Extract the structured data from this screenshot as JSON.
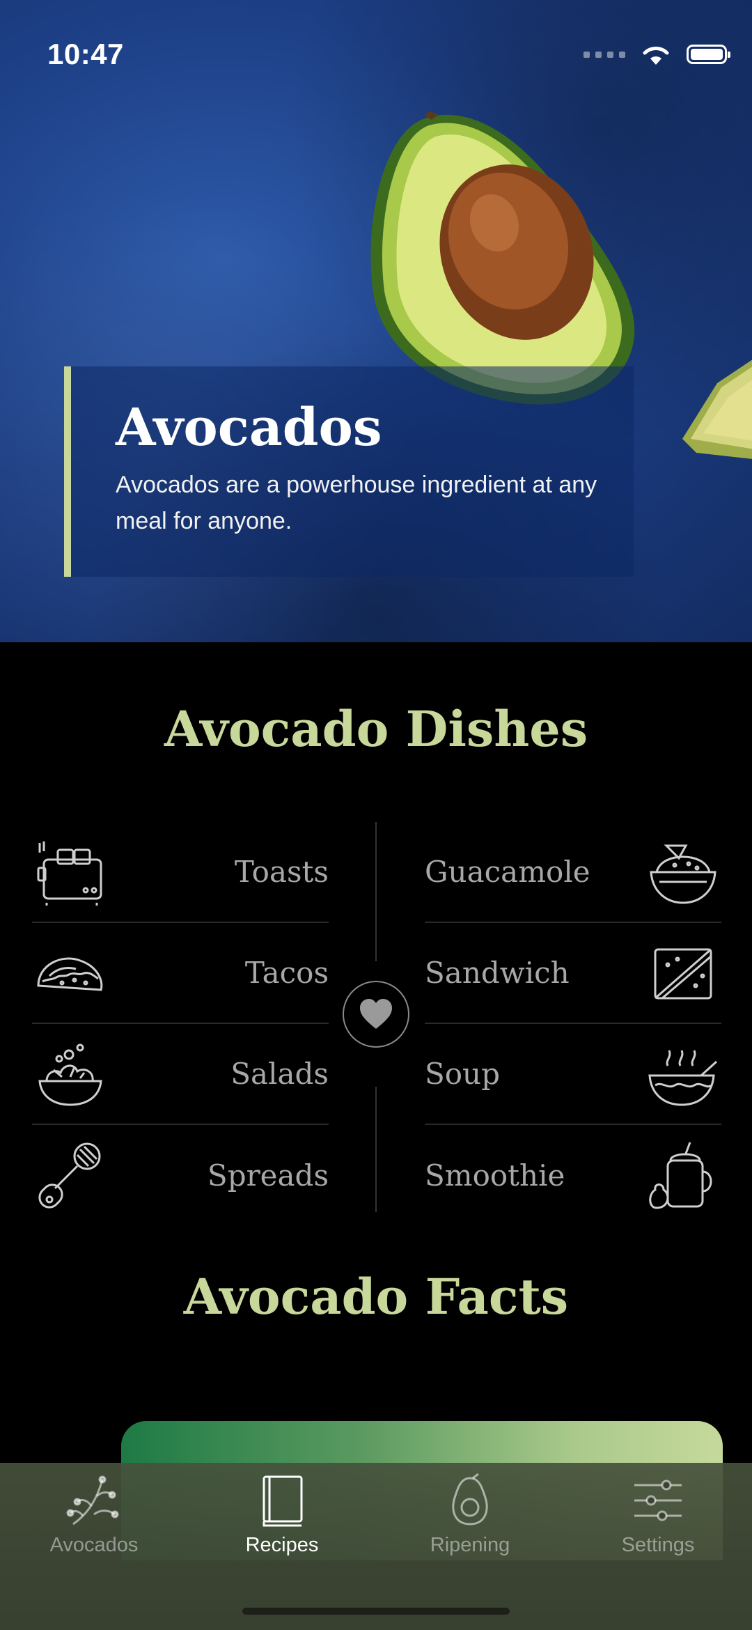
{
  "status_bar": {
    "time": "10:47"
  },
  "hero": {
    "title": "Avocados",
    "description": "Avocados are a powerhouse ingredient at any meal for anyone."
  },
  "dishes": {
    "title": "Avocado Dishes",
    "left": [
      {
        "label": "Toasts",
        "icon": "toaster-icon"
      },
      {
        "label": "Tacos",
        "icon": "taco-icon"
      },
      {
        "label": "Salads",
        "icon": "salad-bowl-icon"
      },
      {
        "label": "Spreads",
        "icon": "masher-icon"
      }
    ],
    "right": [
      {
        "label": "Guacamole",
        "icon": "guacamole-bowl-icon"
      },
      {
        "label": "Sandwich",
        "icon": "sandwich-icon"
      },
      {
        "label": "Soup",
        "icon": "soup-bowl-icon"
      },
      {
        "label": "Smoothie",
        "icon": "smoothie-jar-icon"
      }
    ]
  },
  "facts": {
    "title": "Avocado Facts"
  },
  "tabbar": {
    "tabs": [
      {
        "label": "Avocados",
        "icon": "branch-icon",
        "active": false
      },
      {
        "label": "Recipes",
        "icon": "book-icon",
        "active": true
      },
      {
        "label": "Ripening",
        "icon": "avocado-icon",
        "active": false
      },
      {
        "label": "Settings",
        "icon": "sliders-icon",
        "active": false
      }
    ]
  },
  "colors": {
    "accent": "#c8d89b",
    "hero_bg": "#1d3f86",
    "background": "#000000"
  }
}
